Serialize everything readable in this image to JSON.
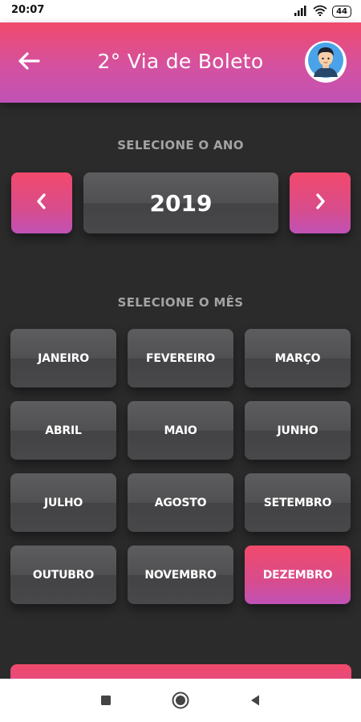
{
  "status_bar": {
    "time": "20:07",
    "battery": "44",
    "icons": [
      "signal-icon",
      "wifi-icon",
      "battery-icon"
    ]
  },
  "header": {
    "title": "2° Via de Boleto",
    "back_icon": "arrow-left-icon",
    "avatar_icon": "user-avatar-icon"
  },
  "year_section": {
    "label": "SELECIONE O ANO",
    "year": "2019",
    "prev_icon": "chevron-left-icon",
    "next_icon": "chevron-right-icon"
  },
  "month_section": {
    "label": "SELECIONE O MÊS",
    "months": [
      {
        "label": "JANEIRO",
        "selected": false
      },
      {
        "label": "FEVEREIRO",
        "selected": false
      },
      {
        "label": "MARÇO",
        "selected": false
      },
      {
        "label": "ABRIL",
        "selected": false
      },
      {
        "label": "MAIO",
        "selected": false
      },
      {
        "label": "JUNHO",
        "selected": false
      },
      {
        "label": "JULHO",
        "selected": false
      },
      {
        "label": "AGOSTO",
        "selected": false
      },
      {
        "label": "SETEMBRO",
        "selected": false
      },
      {
        "label": "OUTUBRO",
        "selected": false
      },
      {
        "label": "NOVEMBRO",
        "selected": false
      },
      {
        "label": "DEZEMBRO",
        "selected": true
      }
    ]
  },
  "system_nav": {
    "icons": [
      "recent-apps-icon",
      "home-icon",
      "back-triangle-icon"
    ]
  },
  "colors": {
    "accent_start": "#f24a6c",
    "accent_end": "#c052b6",
    "background": "#2b2b2c",
    "button_gray": "#505052",
    "label_gray": "#a3a3a3"
  }
}
